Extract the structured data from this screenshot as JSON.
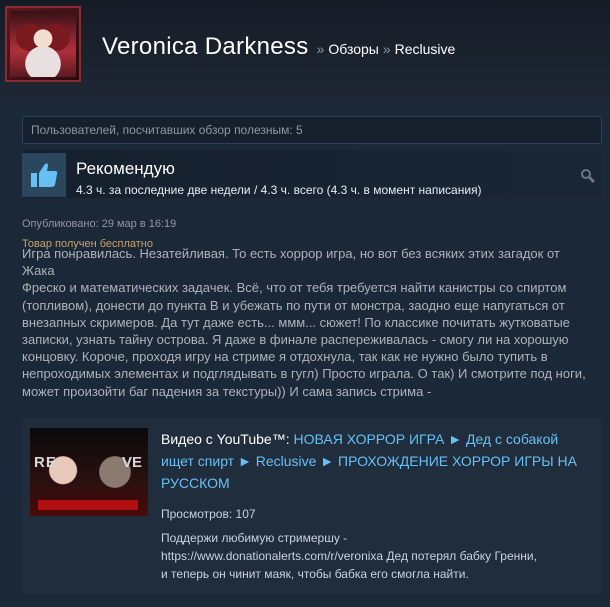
{
  "header": {
    "persona_name": "Veronica Darkness",
    "separator": "»",
    "breadcrumb_reviews": "Обзоры",
    "breadcrumb_game": "Reclusive"
  },
  "review": {
    "helpful_text": "Пользователей, посчитавших обзор полезным: 5",
    "verdict": "Рекомендую",
    "hours": "4.3 ч. за последние две недели / 4.3 ч. всего (4.3 ч. в момент написания)",
    "posted": "Опубликовано: 29 мар в 16:19",
    "free_product": "Товар получен бесплатно",
    "body_lines": [
      "Игра понравилась. Незатейливая. То есть хоррор игра, но вот без всяких этих загадок от Жака",
      "Фреско и математических задачек. Всё, что от тебя требуется найти канистры со спиртом",
      "(топливом), донести до пункта В и убежать по пути от монстра, заодно еще напугаться от",
      "внезапных скримеров. Да тут даже есть... ммм... сюжет! По классике почитать жутковатые",
      "записки, узнать тайну острова. Я даже в финале распереживалась - смогу ли на хорошую",
      "концовку. Короче, проходя игру на стриме я отдохнула, так как не нужно было тупить в",
      "непроходимых элементах и подглядывать в гугл) Просто играла. О так) И смотрите под ноги,",
      "может произойти баг падения за текстуры)) И сама запись стрима -"
    ]
  },
  "video": {
    "prefix": "Видео с YouTube™: ",
    "title": "НОВАЯ ХОРРОР ИГРА ► Дед с собакой ищет спирт ► Reclusive ► ПРОХОЖДЕНИЕ ХОРРОР ИГРЫ НА РУССКОМ",
    "views_label": "Просмотров: ",
    "views_count": "107",
    "desc_lines": [
      "Поддержи любимую стримершу -",
      "https://www.donationalerts.com/r/veronixa Дед потерял бабку Гренни,",
      "и теперь он чинит маяк, чтобы бабка его смогла найти."
    ],
    "thumb_text_left": "RE",
    "thumb_text_right": "VE"
  },
  "colors": {
    "background": "#1b2838",
    "accent_link": "#66c0f4",
    "free_product": "#c6a46b",
    "thumb_box": "#2a475e"
  },
  "icons": {
    "thumbs_up": "thumbs-up-icon",
    "info": "info-search-icon"
  }
}
